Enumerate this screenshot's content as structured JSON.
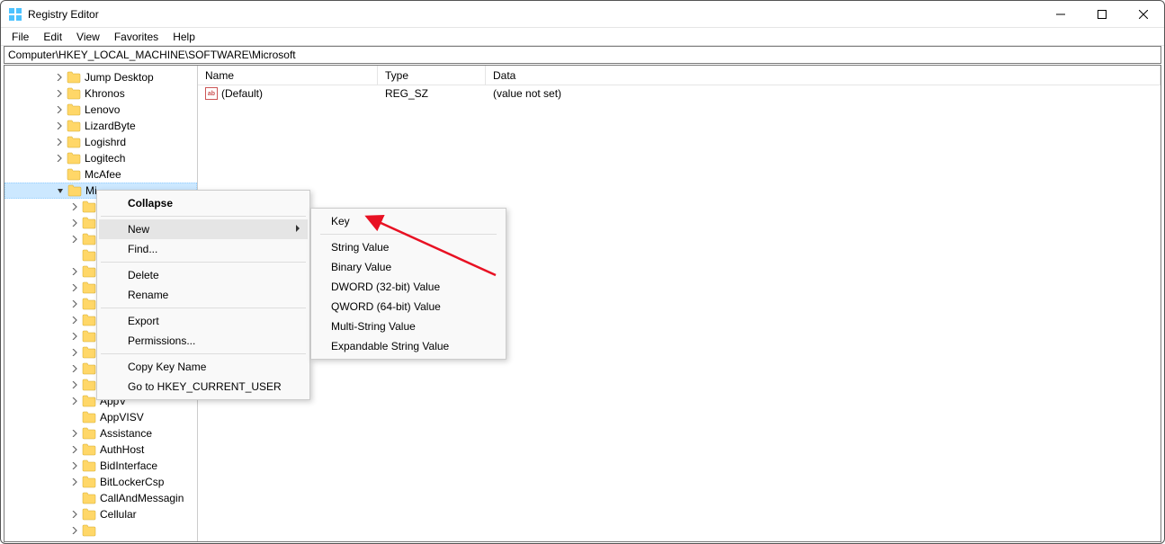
{
  "window": {
    "title": "Registry Editor"
  },
  "menubar": [
    "File",
    "Edit",
    "View",
    "Favorites",
    "Help"
  ],
  "address": "Computer\\HKEY_LOCAL_MACHINE\\SOFTWARE\\Microsoft",
  "tree": [
    {
      "indent": 3,
      "chevron": ">",
      "label": "Jump Desktop"
    },
    {
      "indent": 3,
      "chevron": ">",
      "label": "Khronos"
    },
    {
      "indent": 3,
      "chevron": ">",
      "label": "Lenovo"
    },
    {
      "indent": 3,
      "chevron": ">",
      "label": "LizardByte"
    },
    {
      "indent": 3,
      "chevron": ">",
      "label": "Logishrd"
    },
    {
      "indent": 3,
      "chevron": ">",
      "label": "Logitech"
    },
    {
      "indent": 3,
      "chevron": "",
      "label": "McAfee"
    },
    {
      "indent": 3,
      "chevron": "v",
      "label": "Mi",
      "selected": true
    },
    {
      "indent": 4,
      "chevron": ">",
      "label": ""
    },
    {
      "indent": 4,
      "chevron": ">",
      "label": ""
    },
    {
      "indent": 4,
      "chevron": ">",
      "label": ""
    },
    {
      "indent": 4,
      "chevron": "",
      "label": ""
    },
    {
      "indent": 4,
      "chevron": ">",
      "label": ""
    },
    {
      "indent": 4,
      "chevron": ">",
      "label": ""
    },
    {
      "indent": 4,
      "chevron": ">",
      "label": ""
    },
    {
      "indent": 4,
      "chevron": ">",
      "label": ""
    },
    {
      "indent": 4,
      "chevron": ">",
      "label": ""
    },
    {
      "indent": 4,
      "chevron": ">",
      "label": ""
    },
    {
      "indent": 4,
      "chevron": ">",
      "label": ""
    },
    {
      "indent": 4,
      "chevron": ">",
      "label": ""
    },
    {
      "indent": 4,
      "chevron": ">",
      "label": "AppV"
    },
    {
      "indent": 4,
      "chevron": "",
      "label": "AppVISV"
    },
    {
      "indent": 4,
      "chevron": ">",
      "label": "Assistance"
    },
    {
      "indent": 4,
      "chevron": ">",
      "label": "AuthHost"
    },
    {
      "indent": 4,
      "chevron": ">",
      "label": "BidInterface"
    },
    {
      "indent": 4,
      "chevron": ">",
      "label": "BitLockerCsp"
    },
    {
      "indent": 4,
      "chevron": "",
      "label": "CallAndMessagin"
    },
    {
      "indent": 4,
      "chevron": ">",
      "label": "Cellular"
    },
    {
      "indent": 4,
      "chevron": ">",
      "label": ""
    }
  ],
  "list": {
    "columns": [
      "Name",
      "Type",
      "Data"
    ],
    "rows": [
      {
        "name": "(Default)",
        "type": "REG_SZ",
        "data": "(value not set)"
      }
    ]
  },
  "context_menu": {
    "items": [
      {
        "label": "Collapse",
        "bold": true
      },
      {
        "sep": true
      },
      {
        "label": "New",
        "arrow": true,
        "hover": true
      },
      {
        "label": "Find..."
      },
      {
        "sep": true
      },
      {
        "label": "Delete"
      },
      {
        "label": "Rename"
      },
      {
        "sep": true
      },
      {
        "label": "Export"
      },
      {
        "label": "Permissions..."
      },
      {
        "sep": true
      },
      {
        "label": "Copy Key Name"
      },
      {
        "label": "Go to HKEY_CURRENT_USER"
      }
    ]
  },
  "submenu": {
    "items": [
      {
        "label": "Key"
      },
      {
        "sep": true
      },
      {
        "label": "String Value"
      },
      {
        "label": "Binary Value"
      },
      {
        "label": "DWORD (32-bit) Value"
      },
      {
        "label": "QWORD (64-bit) Value"
      },
      {
        "label": "Multi-String Value"
      },
      {
        "label": "Expandable String Value"
      }
    ]
  }
}
